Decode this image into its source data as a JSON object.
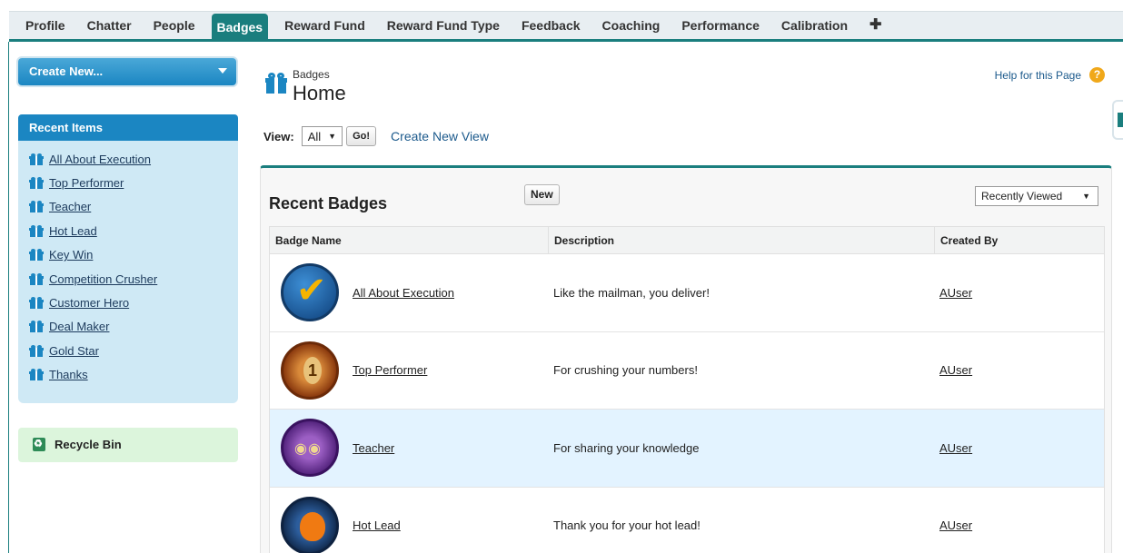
{
  "tabs": [
    {
      "label": "Profile",
      "active": false
    },
    {
      "label": "Chatter",
      "active": false
    },
    {
      "label": "People",
      "active": false
    },
    {
      "label": "Badges",
      "active": true
    },
    {
      "label": "Reward Fund",
      "active": false
    },
    {
      "label": "Reward Fund Type",
      "active": false
    },
    {
      "label": "Feedback",
      "active": false
    },
    {
      "label": "Coaching",
      "active": false
    },
    {
      "label": "Performance",
      "active": false
    },
    {
      "label": "Calibration",
      "active": false
    }
  ],
  "tabs_plus": "✚",
  "sidebar": {
    "create_new_label": "Create New...",
    "recent_items_title": "Recent Items",
    "recent_items": [
      "All About Execution",
      "Top Performer",
      "Teacher",
      "Hot Lead",
      "Key Win",
      "Competition Crusher",
      "Customer Hero",
      "Deal Maker",
      "Gold Star",
      "Thanks"
    ],
    "recycle_bin_label": "Recycle Bin"
  },
  "header": {
    "subtitle": "Badges",
    "title": "Home",
    "help_link": "Help for this Page",
    "help_icon": "?"
  },
  "view": {
    "label": "View:",
    "selected": "All",
    "go_label": "Go!",
    "create_view_link": "Create New View"
  },
  "recent_badges": {
    "title": "Recent Badges",
    "new_button": "New",
    "sort_selected": "Recently Viewed",
    "columns": [
      "Badge Name",
      "Description",
      "Created By"
    ],
    "rows": [
      {
        "name": "All About Execution",
        "description": "Like the mailman, you deliver!",
        "created_by": "AUser",
        "icon": "checkmark-badge-icon",
        "highlight": false
      },
      {
        "name": "Top Performer",
        "description": "For crushing your numbers!",
        "created_by": "AUser",
        "icon": "medal-badge-icon",
        "highlight": false
      },
      {
        "name": "Teacher",
        "description": "For sharing your knowledge",
        "created_by": "AUser",
        "icon": "owl-badge-icon",
        "highlight": true
      },
      {
        "name": "Hot Lead",
        "description": "Thank you for your hot lead!",
        "created_by": "AUser",
        "icon": "fire-fox-badge-icon",
        "highlight": false
      }
    ]
  },
  "colors": {
    "accent": "#1a7e7e",
    "sidebar_blue": "#1b86c2",
    "recent_bg": "#cfe9f5",
    "row_highlight": "#e3f3ff"
  }
}
